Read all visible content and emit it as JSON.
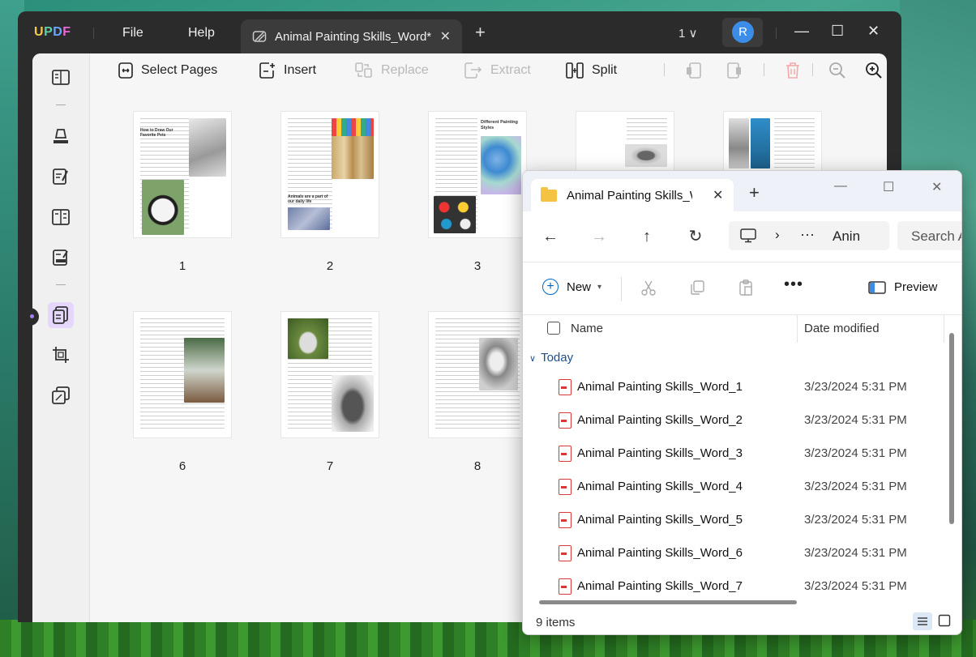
{
  "updf": {
    "logo": [
      "U",
      "P",
      "D",
      "F"
    ],
    "menu": {
      "file": "File",
      "help": "Help"
    },
    "tab": {
      "title": "Animal Painting Skills_Word*",
      "close": "✕"
    },
    "new_tab": "+",
    "page_indicator": "1 ∨",
    "avatar": "R",
    "window": {
      "minimize": "—",
      "maximize": "☐",
      "close": "✕"
    },
    "toolbar": {
      "select_pages": "Select Pages",
      "insert": "Insert",
      "replace": "Replace",
      "extract": "Extract",
      "split": "Split"
    },
    "pages": [
      {
        "label": "1"
      },
      {
        "label": "2"
      },
      {
        "label": "3"
      },
      {
        "label": "6"
      },
      {
        "label": "7"
      },
      {
        "label": "8"
      }
    ],
    "thumb_text": {
      "p1_heading": "How to Draw Our Favorite Pets",
      "p2_heading": "Animals are a part of our daily life",
      "p3_heading": "Different Painting Styles"
    }
  },
  "explorer": {
    "tab_title": "Animal Painting Skills_Word",
    "tab_close": "✕",
    "new_tab": "+",
    "window": {
      "minimize": "—",
      "maximize": "☐",
      "close": "✕"
    },
    "nav": {
      "back": "←",
      "forward": "→",
      "up": "↑",
      "refresh": "↻"
    },
    "address": {
      "chevron": "›",
      "dots": "···",
      "crumb": "Anin"
    },
    "search_placeholder": "Search A",
    "commands": {
      "new": "New",
      "more": "•••",
      "preview": "Preview"
    },
    "columns": {
      "name": "Name",
      "date": "Date modified"
    },
    "group": "Today",
    "files": [
      {
        "name": "Animal Painting Skills_Word_1",
        "date": "3/23/2024 5:31 PM"
      },
      {
        "name": "Animal Painting Skills_Word_2",
        "date": "3/23/2024 5:31 PM"
      },
      {
        "name": "Animal Painting Skills_Word_3",
        "date": "3/23/2024 5:31 PM"
      },
      {
        "name": "Animal Painting Skills_Word_4",
        "date": "3/23/2024 5:31 PM"
      },
      {
        "name": "Animal Painting Skills_Word_5",
        "date": "3/23/2024 5:31 PM"
      },
      {
        "name": "Animal Painting Skills_Word_6",
        "date": "3/23/2024 5:31 PM"
      },
      {
        "name": "Animal Painting Skills_Word_7",
        "date": "3/23/2024 5:31 PM"
      }
    ],
    "status": "9 items"
  }
}
